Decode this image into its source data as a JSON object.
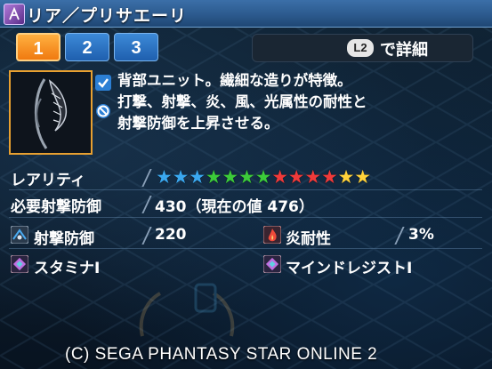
{
  "title": "リア／プリサエーリ",
  "tabs": [
    {
      "label": "1",
      "active": true
    },
    {
      "label": "2",
      "active": false
    },
    {
      "label": "3",
      "active": false
    }
  ],
  "detail_button": {
    "key": "L2",
    "label": "で詳細"
  },
  "side_icons": [
    "checkmark-icon",
    "no-entry-icon"
  ],
  "description": [
    "背部ユニット。繊細な造りが特徴。",
    "打撃、射撃、炎、風、光属性の耐性と",
    "射撃防御を上昇させる。"
  ],
  "rarity": {
    "label": "レアリティ",
    "stars": 13,
    "star_colors": [
      "#3aa8f0",
      "#3aa8f0",
      "#3aa8f0",
      "#3ccb3a",
      "#3ccb3a",
      "#3ccb3a",
      "#3ccb3a",
      "#f03a3a",
      "#f03a3a",
      "#f03a3a",
      "#f03a3a",
      "#ffd23a",
      "#ffd23a"
    ]
  },
  "requirement": {
    "label": "必要射撃防御",
    "value": "430（現在の値 476）"
  },
  "stats": [
    {
      "label": "射撃防御",
      "value": "220",
      "icon": "ranged-defense-icon"
    },
    {
      "label": "炎耐性",
      "value": "3%",
      "icon": "fire-resist-icon"
    }
  ],
  "abilities": [
    {
      "label": "スタミナⅠ",
      "icon": "ability-icon"
    },
    {
      "label": "マインドレジストⅠ",
      "icon": "ability-icon"
    }
  ],
  "copyright": "(C)  SEGA PHANTASY STAR ONLINE 2"
}
